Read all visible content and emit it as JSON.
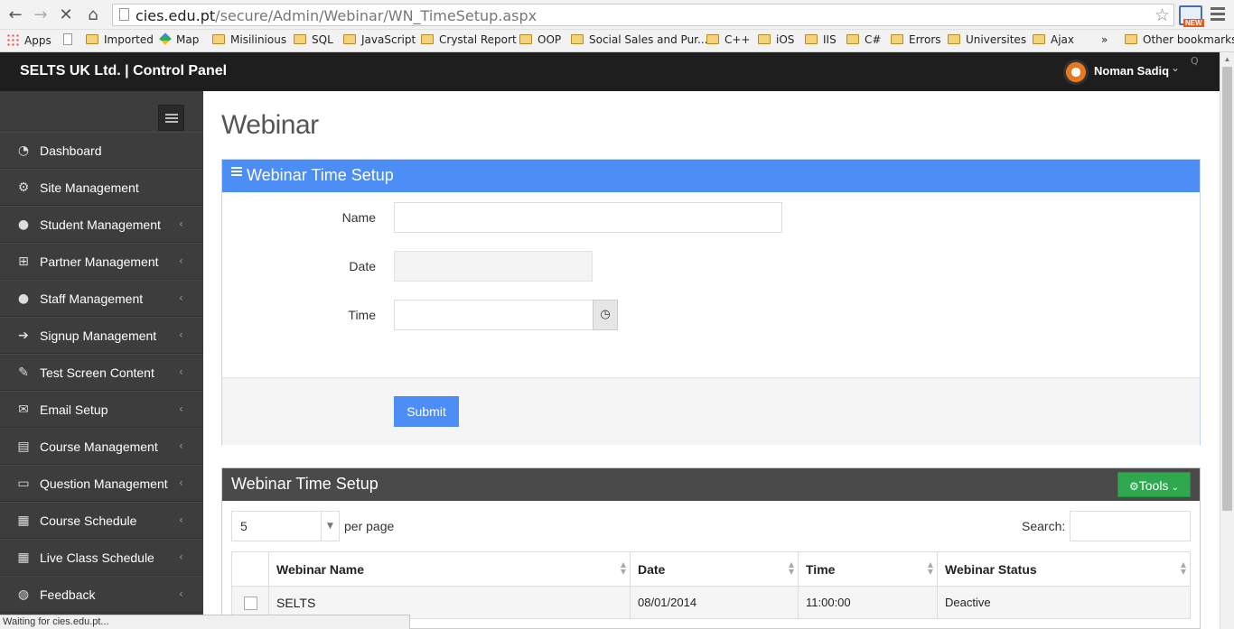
{
  "browser": {
    "url_host": "cies.edu.pt",
    "url_path": "/secure/Admin/Webinar/WN_TimeSetup.aspx",
    "status_text": "Waiting for cies.edu.pt...",
    "ext_badge": "NEW",
    "bookmarks": [
      "Apps",
      "Imported",
      "Map",
      "Misilinious",
      "SQL",
      "JavaScript",
      "Crystal Report",
      "OOP",
      "Social Sales and Pur...",
      "C++",
      "iOS",
      "IIS",
      "C#",
      "Errors",
      "Universites",
      "Ajax"
    ],
    "overflow": "»",
    "other_bookmarks": "Other bookmarks"
  },
  "header": {
    "brand": "SELTS UK Ltd. | Control Panel",
    "user_name": "Noman Sadiq",
    "search_glyph": "Q"
  },
  "sidebar": {
    "items": [
      {
        "label": "Dashboard",
        "icon": "dashboard-icon",
        "arrow": ""
      },
      {
        "label": "Site Management",
        "icon": "cogs-icon",
        "arrow": ""
      },
      {
        "label": "Student Management",
        "icon": "user-icon",
        "arrow": "‹"
      },
      {
        "label": "Partner Management",
        "icon": "sitemap-icon",
        "arrow": "‹"
      },
      {
        "label": "Staff Management",
        "icon": "users-icon",
        "arrow": "‹"
      },
      {
        "label": "Signup Management",
        "icon": "sign-in-icon",
        "arrow": "‹"
      },
      {
        "label": "Test Screen Content",
        "icon": "edit-icon",
        "arrow": "‹"
      },
      {
        "label": "Email Setup",
        "icon": "envelope-icon",
        "arrow": "‹"
      },
      {
        "label": "Course Management",
        "icon": "book-icon",
        "arrow": "‹"
      },
      {
        "label": "Question Management",
        "icon": "folder-open-icon",
        "arrow": "‹"
      },
      {
        "label": "Course Schedule",
        "icon": "calendar-icon",
        "arrow": "‹"
      },
      {
        "label": "Live Class Schedule",
        "icon": "calendar-icon",
        "arrow": "‹"
      },
      {
        "label": "Feedback",
        "icon": "comments-icon",
        "arrow": "‹"
      }
    ]
  },
  "main": {
    "page_title": "Webinar",
    "form_panel": {
      "title": "Webinar Time Setup",
      "name_label": "Name",
      "name_value": "",
      "date_label": "Date",
      "date_value": "",
      "time_label": "Time",
      "time_value": "",
      "submit_label": "Submit"
    },
    "table_panel": {
      "title": "Webinar Time Setup",
      "tools_label": "Tools",
      "per_page_value": "5",
      "per_page_label": "per page",
      "search_label": "Search:",
      "columns": [
        "Webinar Name",
        "Date",
        "Time",
        "Webinar Status"
      ],
      "rows": [
        {
          "name": "SELTS",
          "date": "08/01/2014",
          "time": "11:00:00",
          "status": "Deactive"
        }
      ]
    }
  },
  "colors": {
    "primary": "#4c8df6",
    "sidebar_bg": "#3d3d3d",
    "header_bg": "#1e1e1e",
    "tools_green": "#2fa84f"
  }
}
